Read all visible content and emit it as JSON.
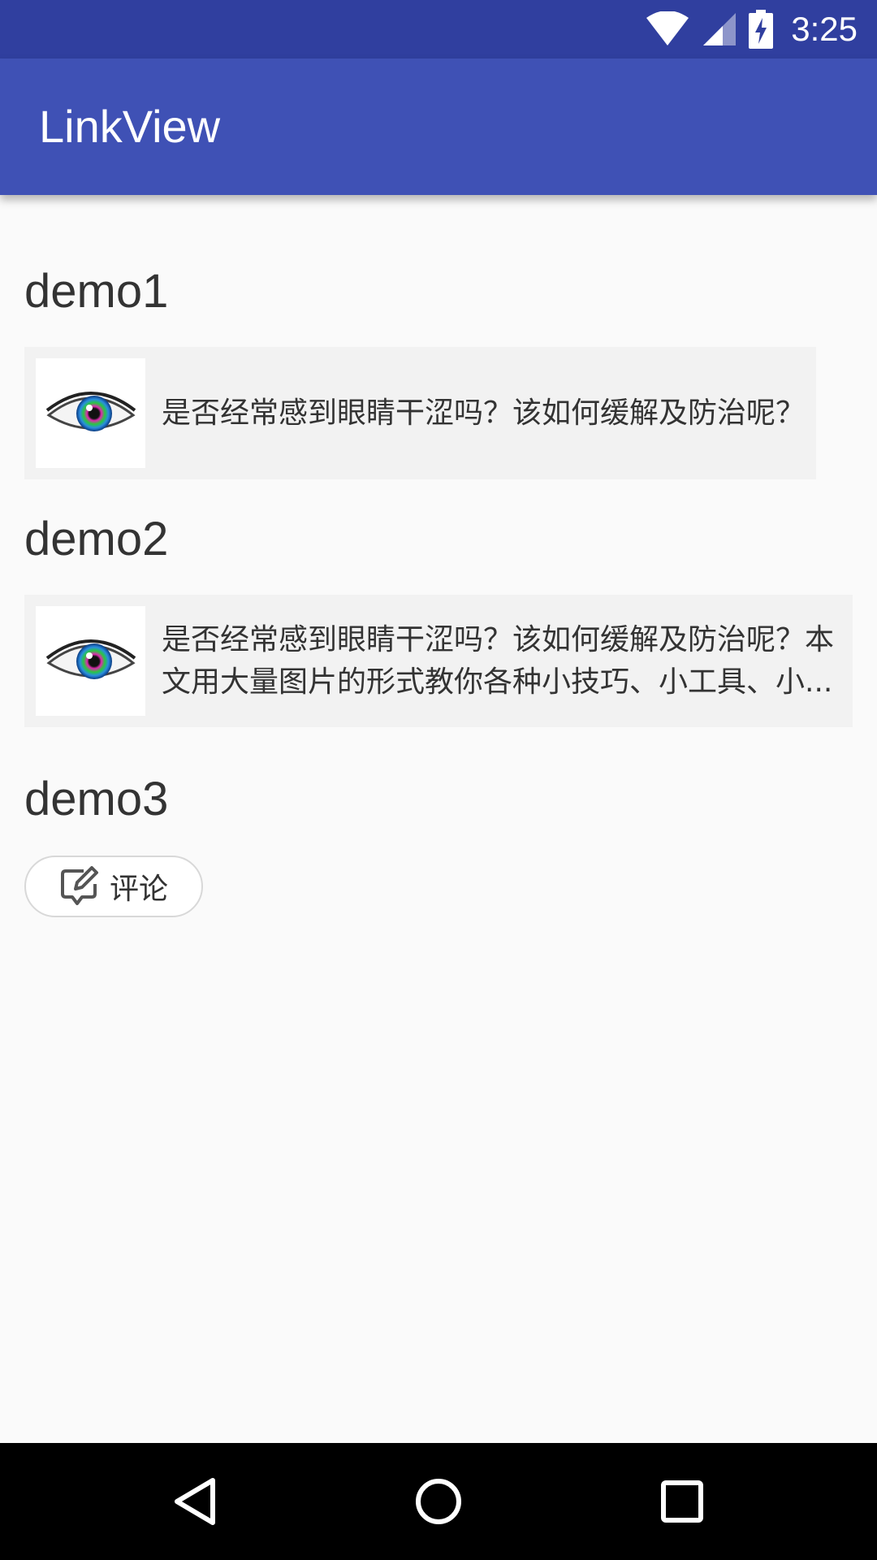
{
  "status_bar": {
    "time": "3:25",
    "icons": [
      "wifi-icon",
      "cell-signal-icon",
      "battery-charging-icon"
    ]
  },
  "app_bar": {
    "title": "LinkView"
  },
  "demo1": {
    "title": "demo1",
    "card_text": "是否经常感到眼睛干涩吗？该如何缓解及防治呢？",
    "thumbnail_icon": "eye-image"
  },
  "demo2": {
    "title": "demo2",
    "card_text": "是否经常感到眼睛干涩吗？该如何缓解及防治呢？本文用大量图片的形式教你各种小技巧、小工具、小...",
    "thumbnail_icon": "eye-image"
  },
  "demo3": {
    "title": "demo3",
    "comment_label": "评论",
    "comment_icon": "edit-comment-icon"
  },
  "nav_bar": {
    "icons": [
      "back-icon",
      "home-icon",
      "recents-icon"
    ]
  },
  "colors": {
    "status_bar": "#303f9f",
    "app_bar": "#3f51b5",
    "background": "#fafafa",
    "card": "#f2f2f2"
  }
}
